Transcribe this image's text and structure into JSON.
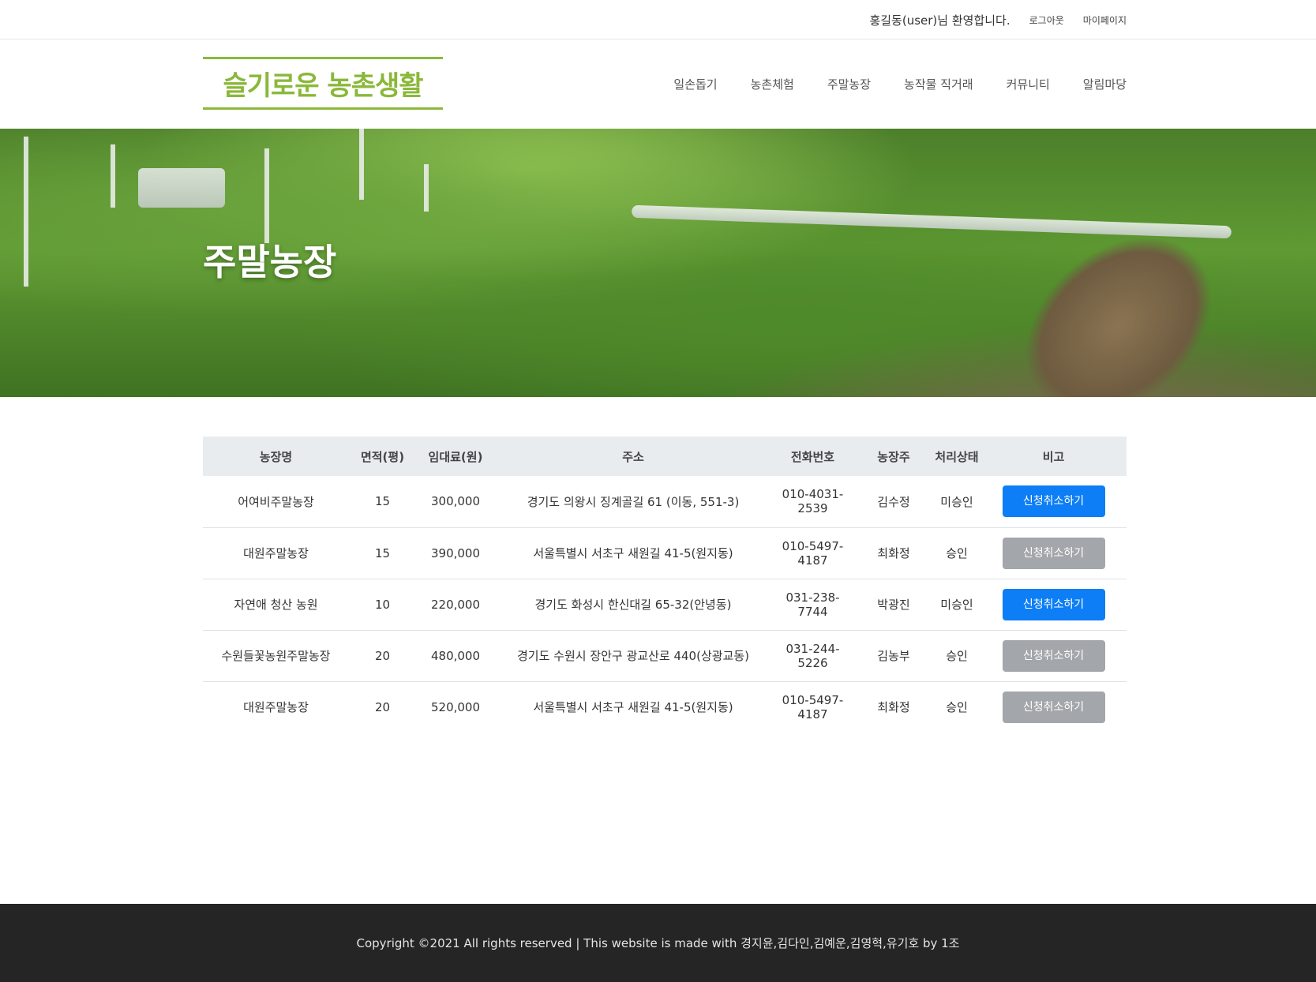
{
  "topbar": {
    "welcome": "홍길동(user)님 환영합니다.",
    "logout": "로그아웃",
    "mypage": "마이페이지"
  },
  "header": {
    "logo": "슬기로운 농촌생활",
    "nav": [
      "일손돕기",
      "농촌체험",
      "주말농장",
      "농작물 직거래",
      "커뮤니티",
      "알림마당"
    ]
  },
  "hero": {
    "title": "주말농장"
  },
  "table": {
    "headers": [
      "농장명",
      "면적(평)",
      "임대료(원)",
      "주소",
      "전화번호",
      "농장주",
      "처리상태",
      "비고"
    ],
    "rows": [
      {
        "name": "어여비주말농장",
        "area": "15",
        "rent": "300,000",
        "address": "경기도 의왕시 징계골길 61 (이동, 551-3)",
        "phone": "010-4031-2539",
        "owner": "김수정",
        "status": "미승인",
        "action": "신청취소하기",
        "action_style": "blue"
      },
      {
        "name": "대원주말농장",
        "area": "15",
        "rent": "390,000",
        "address": "서울특별시 서초구 새원길 41-5(원지동)",
        "phone": "010-5497-4187",
        "owner": "최화정",
        "status": "승인",
        "action": "신청취소하기",
        "action_style": "grey"
      },
      {
        "name": "자연애 청산 농원",
        "area": "10",
        "rent": "220,000",
        "address": "경기도 화성시 한신대길 65-32(안녕동)",
        "phone": "031-238-7744",
        "owner": "박광진",
        "status": "미승인",
        "action": "신청취소하기",
        "action_style": "blue"
      },
      {
        "name": "수원들꽃농원주말농장",
        "area": "20",
        "rent": "480,000",
        "address": "경기도 수원시 장안구 광교산로 440(상광교동)",
        "phone": "031-244-5226",
        "owner": "김농부",
        "status": "승인",
        "action": "신청취소하기",
        "action_style": "grey"
      },
      {
        "name": "대원주말농장",
        "area": "20",
        "rent": "520,000",
        "address": "서울특별시 서초구 새원길 41-5(원지동)",
        "phone": "010-5497-4187",
        "owner": "최화정",
        "status": "승인",
        "action": "신청취소하기",
        "action_style": "grey"
      }
    ]
  },
  "footer": {
    "text": "Copyright ©2021 All rights reserved | This website is made with 경지윤,김다인,김예운,김영혁,유기호 by 1조"
  },
  "colors": {
    "brand": "#8ab83a",
    "button_active": "#0d7ef5",
    "button_disabled": "#a3a6aa",
    "footer_bg": "#252525",
    "table_header_bg": "#e9ecef"
  }
}
